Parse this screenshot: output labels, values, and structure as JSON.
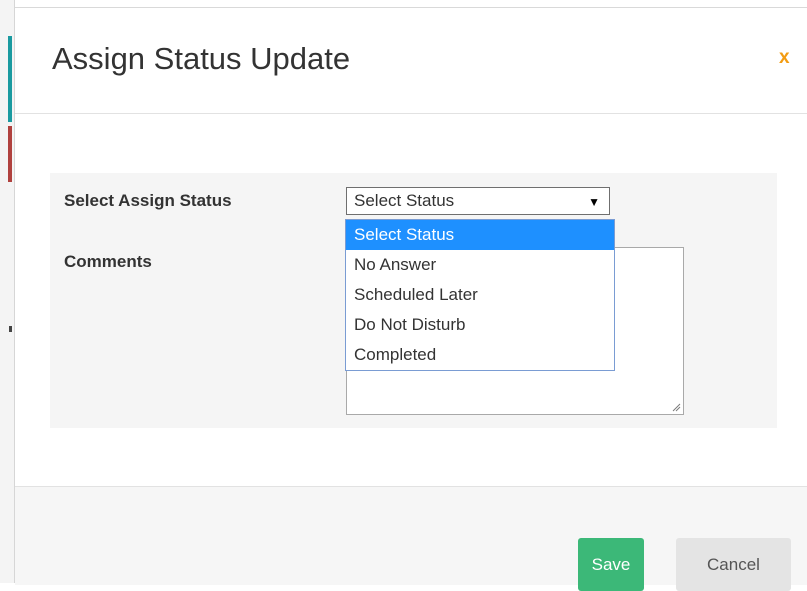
{
  "modal": {
    "title": "Assign Status Update",
    "close_label": "x"
  },
  "form": {
    "status_label": "Select Assign Status",
    "comments_label": "Comments",
    "status_select": {
      "selected_value": "Select Status",
      "options": [
        "Select Status",
        "No Answer",
        "Scheduled Later",
        "Do Not Disturb",
        "Completed"
      ],
      "highlighted_option": "Select Status",
      "expanded": true
    },
    "comments_value": ""
  },
  "footer": {
    "save_label": "Save",
    "cancel_label": "Cancel"
  },
  "colors": {
    "close_accent": "#f39c12",
    "save_button": "#3cb878",
    "cancel_button": "#e4e4e4",
    "option_highlight": "#1e90ff"
  },
  "icons": {
    "select_arrow": "triangle-down-icon",
    "resize_grip": "resize-grip-icon"
  }
}
